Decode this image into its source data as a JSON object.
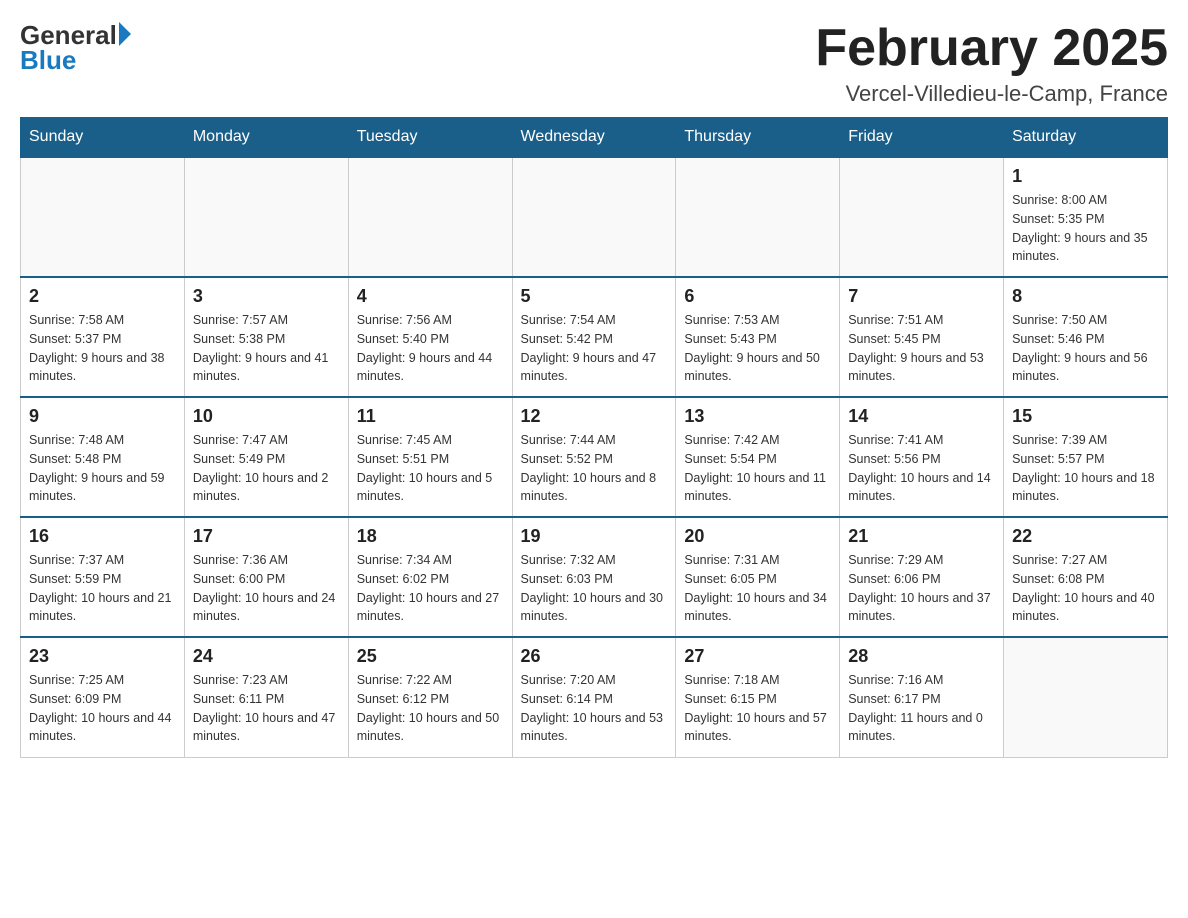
{
  "header": {
    "logo_general": "General",
    "logo_blue": "Blue",
    "month_title": "February 2025",
    "location": "Vercel-Villedieu-le-Camp, France"
  },
  "weekdays": [
    "Sunday",
    "Monday",
    "Tuesday",
    "Wednesday",
    "Thursday",
    "Friday",
    "Saturday"
  ],
  "weeks": [
    [
      {
        "day": "",
        "info": ""
      },
      {
        "day": "",
        "info": ""
      },
      {
        "day": "",
        "info": ""
      },
      {
        "day": "",
        "info": ""
      },
      {
        "day": "",
        "info": ""
      },
      {
        "day": "",
        "info": ""
      },
      {
        "day": "1",
        "info": "Sunrise: 8:00 AM\nSunset: 5:35 PM\nDaylight: 9 hours and 35 minutes."
      }
    ],
    [
      {
        "day": "2",
        "info": "Sunrise: 7:58 AM\nSunset: 5:37 PM\nDaylight: 9 hours and 38 minutes."
      },
      {
        "day": "3",
        "info": "Sunrise: 7:57 AM\nSunset: 5:38 PM\nDaylight: 9 hours and 41 minutes."
      },
      {
        "day": "4",
        "info": "Sunrise: 7:56 AM\nSunset: 5:40 PM\nDaylight: 9 hours and 44 minutes."
      },
      {
        "day": "5",
        "info": "Sunrise: 7:54 AM\nSunset: 5:42 PM\nDaylight: 9 hours and 47 minutes."
      },
      {
        "day": "6",
        "info": "Sunrise: 7:53 AM\nSunset: 5:43 PM\nDaylight: 9 hours and 50 minutes."
      },
      {
        "day": "7",
        "info": "Sunrise: 7:51 AM\nSunset: 5:45 PM\nDaylight: 9 hours and 53 minutes."
      },
      {
        "day": "8",
        "info": "Sunrise: 7:50 AM\nSunset: 5:46 PM\nDaylight: 9 hours and 56 minutes."
      }
    ],
    [
      {
        "day": "9",
        "info": "Sunrise: 7:48 AM\nSunset: 5:48 PM\nDaylight: 9 hours and 59 minutes."
      },
      {
        "day": "10",
        "info": "Sunrise: 7:47 AM\nSunset: 5:49 PM\nDaylight: 10 hours and 2 minutes."
      },
      {
        "day": "11",
        "info": "Sunrise: 7:45 AM\nSunset: 5:51 PM\nDaylight: 10 hours and 5 minutes."
      },
      {
        "day": "12",
        "info": "Sunrise: 7:44 AM\nSunset: 5:52 PM\nDaylight: 10 hours and 8 minutes."
      },
      {
        "day": "13",
        "info": "Sunrise: 7:42 AM\nSunset: 5:54 PM\nDaylight: 10 hours and 11 minutes."
      },
      {
        "day": "14",
        "info": "Sunrise: 7:41 AM\nSunset: 5:56 PM\nDaylight: 10 hours and 14 minutes."
      },
      {
        "day": "15",
        "info": "Sunrise: 7:39 AM\nSunset: 5:57 PM\nDaylight: 10 hours and 18 minutes."
      }
    ],
    [
      {
        "day": "16",
        "info": "Sunrise: 7:37 AM\nSunset: 5:59 PM\nDaylight: 10 hours and 21 minutes."
      },
      {
        "day": "17",
        "info": "Sunrise: 7:36 AM\nSunset: 6:00 PM\nDaylight: 10 hours and 24 minutes."
      },
      {
        "day": "18",
        "info": "Sunrise: 7:34 AM\nSunset: 6:02 PM\nDaylight: 10 hours and 27 minutes."
      },
      {
        "day": "19",
        "info": "Sunrise: 7:32 AM\nSunset: 6:03 PM\nDaylight: 10 hours and 30 minutes."
      },
      {
        "day": "20",
        "info": "Sunrise: 7:31 AM\nSunset: 6:05 PM\nDaylight: 10 hours and 34 minutes."
      },
      {
        "day": "21",
        "info": "Sunrise: 7:29 AM\nSunset: 6:06 PM\nDaylight: 10 hours and 37 minutes."
      },
      {
        "day": "22",
        "info": "Sunrise: 7:27 AM\nSunset: 6:08 PM\nDaylight: 10 hours and 40 minutes."
      }
    ],
    [
      {
        "day": "23",
        "info": "Sunrise: 7:25 AM\nSunset: 6:09 PM\nDaylight: 10 hours and 44 minutes."
      },
      {
        "day": "24",
        "info": "Sunrise: 7:23 AM\nSunset: 6:11 PM\nDaylight: 10 hours and 47 minutes."
      },
      {
        "day": "25",
        "info": "Sunrise: 7:22 AM\nSunset: 6:12 PM\nDaylight: 10 hours and 50 minutes."
      },
      {
        "day": "26",
        "info": "Sunrise: 7:20 AM\nSunset: 6:14 PM\nDaylight: 10 hours and 53 minutes."
      },
      {
        "day": "27",
        "info": "Sunrise: 7:18 AM\nSunset: 6:15 PM\nDaylight: 10 hours and 57 minutes."
      },
      {
        "day": "28",
        "info": "Sunrise: 7:16 AM\nSunset: 6:17 PM\nDaylight: 11 hours and 0 minutes."
      },
      {
        "day": "",
        "info": ""
      }
    ]
  ]
}
